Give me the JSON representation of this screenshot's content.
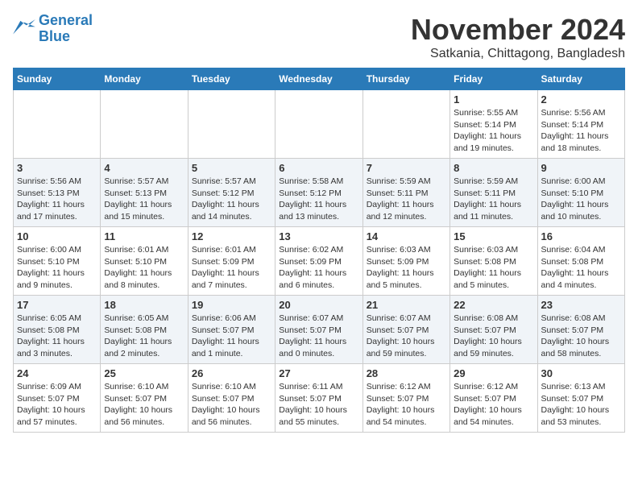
{
  "logo": {
    "line1": "General",
    "line2": "Blue"
  },
  "title": "November 2024",
  "location": "Satkania, Chittagong, Bangladesh",
  "weekdays": [
    "Sunday",
    "Monday",
    "Tuesday",
    "Wednesday",
    "Thursday",
    "Friday",
    "Saturday"
  ],
  "weeks": [
    [
      {
        "day": "",
        "info": ""
      },
      {
        "day": "",
        "info": ""
      },
      {
        "day": "",
        "info": ""
      },
      {
        "day": "",
        "info": ""
      },
      {
        "day": "",
        "info": ""
      },
      {
        "day": "1",
        "info": "Sunrise: 5:55 AM\nSunset: 5:14 PM\nDaylight: 11 hours and 19 minutes."
      },
      {
        "day": "2",
        "info": "Sunrise: 5:56 AM\nSunset: 5:14 PM\nDaylight: 11 hours and 18 minutes."
      }
    ],
    [
      {
        "day": "3",
        "info": "Sunrise: 5:56 AM\nSunset: 5:13 PM\nDaylight: 11 hours and 17 minutes."
      },
      {
        "day": "4",
        "info": "Sunrise: 5:57 AM\nSunset: 5:13 PM\nDaylight: 11 hours and 15 minutes."
      },
      {
        "day": "5",
        "info": "Sunrise: 5:57 AM\nSunset: 5:12 PM\nDaylight: 11 hours and 14 minutes."
      },
      {
        "day": "6",
        "info": "Sunrise: 5:58 AM\nSunset: 5:12 PM\nDaylight: 11 hours and 13 minutes."
      },
      {
        "day": "7",
        "info": "Sunrise: 5:59 AM\nSunset: 5:11 PM\nDaylight: 11 hours and 12 minutes."
      },
      {
        "day": "8",
        "info": "Sunrise: 5:59 AM\nSunset: 5:11 PM\nDaylight: 11 hours and 11 minutes."
      },
      {
        "day": "9",
        "info": "Sunrise: 6:00 AM\nSunset: 5:10 PM\nDaylight: 11 hours and 10 minutes."
      }
    ],
    [
      {
        "day": "10",
        "info": "Sunrise: 6:00 AM\nSunset: 5:10 PM\nDaylight: 11 hours and 9 minutes."
      },
      {
        "day": "11",
        "info": "Sunrise: 6:01 AM\nSunset: 5:10 PM\nDaylight: 11 hours and 8 minutes."
      },
      {
        "day": "12",
        "info": "Sunrise: 6:01 AM\nSunset: 5:09 PM\nDaylight: 11 hours and 7 minutes."
      },
      {
        "day": "13",
        "info": "Sunrise: 6:02 AM\nSunset: 5:09 PM\nDaylight: 11 hours and 6 minutes."
      },
      {
        "day": "14",
        "info": "Sunrise: 6:03 AM\nSunset: 5:09 PM\nDaylight: 11 hours and 5 minutes."
      },
      {
        "day": "15",
        "info": "Sunrise: 6:03 AM\nSunset: 5:08 PM\nDaylight: 11 hours and 5 minutes."
      },
      {
        "day": "16",
        "info": "Sunrise: 6:04 AM\nSunset: 5:08 PM\nDaylight: 11 hours and 4 minutes."
      }
    ],
    [
      {
        "day": "17",
        "info": "Sunrise: 6:05 AM\nSunset: 5:08 PM\nDaylight: 11 hours and 3 minutes."
      },
      {
        "day": "18",
        "info": "Sunrise: 6:05 AM\nSunset: 5:08 PM\nDaylight: 11 hours and 2 minutes."
      },
      {
        "day": "19",
        "info": "Sunrise: 6:06 AM\nSunset: 5:07 PM\nDaylight: 11 hours and 1 minute."
      },
      {
        "day": "20",
        "info": "Sunrise: 6:07 AM\nSunset: 5:07 PM\nDaylight: 11 hours and 0 minutes."
      },
      {
        "day": "21",
        "info": "Sunrise: 6:07 AM\nSunset: 5:07 PM\nDaylight: 10 hours and 59 minutes."
      },
      {
        "day": "22",
        "info": "Sunrise: 6:08 AM\nSunset: 5:07 PM\nDaylight: 10 hours and 59 minutes."
      },
      {
        "day": "23",
        "info": "Sunrise: 6:08 AM\nSunset: 5:07 PM\nDaylight: 10 hours and 58 minutes."
      }
    ],
    [
      {
        "day": "24",
        "info": "Sunrise: 6:09 AM\nSunset: 5:07 PM\nDaylight: 10 hours and 57 minutes."
      },
      {
        "day": "25",
        "info": "Sunrise: 6:10 AM\nSunset: 5:07 PM\nDaylight: 10 hours and 56 minutes."
      },
      {
        "day": "26",
        "info": "Sunrise: 6:10 AM\nSunset: 5:07 PM\nDaylight: 10 hours and 56 minutes."
      },
      {
        "day": "27",
        "info": "Sunrise: 6:11 AM\nSunset: 5:07 PM\nDaylight: 10 hours and 55 minutes."
      },
      {
        "day": "28",
        "info": "Sunrise: 6:12 AM\nSunset: 5:07 PM\nDaylight: 10 hours and 54 minutes."
      },
      {
        "day": "29",
        "info": "Sunrise: 6:12 AM\nSunset: 5:07 PM\nDaylight: 10 hours and 54 minutes."
      },
      {
        "day": "30",
        "info": "Sunrise: 6:13 AM\nSunset: 5:07 PM\nDaylight: 10 hours and 53 minutes."
      }
    ]
  ]
}
